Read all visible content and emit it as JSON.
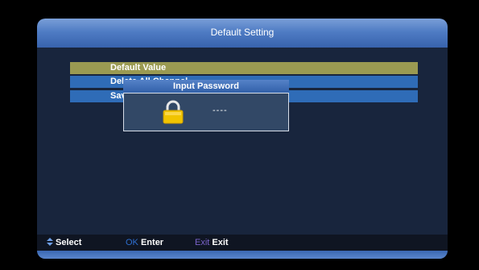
{
  "window": {
    "title": "Default Setting"
  },
  "menu": {
    "items": [
      {
        "label": "Default Value",
        "selected": true
      },
      {
        "label": "Delete All Channel",
        "selected": false
      },
      {
        "label": "Save default value",
        "selected": false
      }
    ]
  },
  "dialog": {
    "title": "Input Password",
    "password_mask": "----",
    "icon": "lock-icon"
  },
  "help": {
    "select_label": "Select",
    "ok_key": "OK",
    "ok_label": "Enter",
    "exit_key": "Exit",
    "exit_label": "Exit"
  },
  "colors": {
    "title_bar": "#4f7cc4",
    "selected_item": "#9a9a52",
    "normal_item": "#2f6cb7",
    "lock": "#f1c400"
  }
}
